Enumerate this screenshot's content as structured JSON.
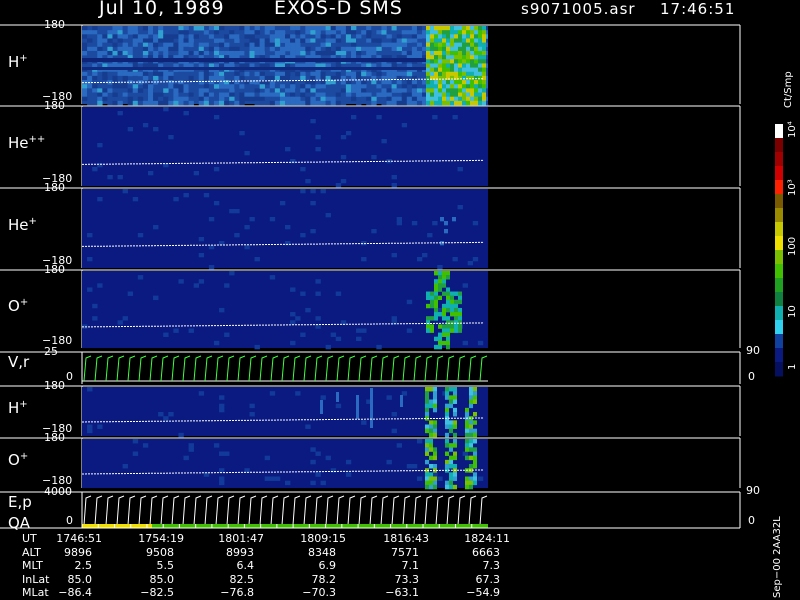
{
  "header": {
    "date": "Jul 10, 1989",
    "instrument": "EXOS-D SMS",
    "file": "s9071005.asr",
    "time": "17:46:51"
  },
  "panels": [
    {
      "label_main": "H",
      "label_sup": "+",
      "top_tick": "180",
      "bottom_tick": "−180"
    },
    {
      "label_main": "He",
      "label_sup": "++",
      "top_tick": "180",
      "bottom_tick": "−180"
    },
    {
      "label_main": "He",
      "label_sup": "+",
      "top_tick": "180",
      "bottom_tick": "−180"
    },
    {
      "label_main": "O",
      "label_sup": "+",
      "top_tick": "180",
      "bottom_tick": "−180"
    },
    {
      "label_main": "V,r",
      "label_sup": "",
      "top_tick": "25",
      "bottom_tick": "0",
      "right_top": "90",
      "right_bottom": "0"
    },
    {
      "label_main": "H",
      "label_sup": "+",
      "top_tick": "180",
      "bottom_tick": "−180"
    },
    {
      "label_main": "O",
      "label_sup": "+",
      "top_tick": "180",
      "bottom_tick": "−180"
    },
    {
      "label_main": "E,p",
      "label_sup": "",
      "label2": "QA",
      "top_tick": "4000",
      "bottom_tick": "0",
      "right_top": "90",
      "right_bottom": "0"
    }
  ],
  "colorbar": {
    "title": "Ct/Smp",
    "tick_labels": [
      "10⁴",
      "10³",
      "100",
      "10",
      "1"
    ],
    "colors": [
      "#ffffff",
      "#7a0000",
      "#a00000",
      "#d00000",
      "#ff2000",
      "#7a5a00",
      "#9a8a00",
      "#c8c800",
      "#f0e000",
      "#7ac000",
      "#40c000",
      "#20a020",
      "#108040",
      "#10b0b0",
      "#30d0f0",
      "#1040a0",
      "#0a1a80",
      "#061060"
    ]
  },
  "ephemeris": {
    "rows": [
      {
        "name": "UT",
        "values": [
          "1746:51",
          "1754:19",
          "1801:47",
          "1809:15",
          "1816:43",
          "1824:11"
        ]
      },
      {
        "name": "ALT",
        "values": [
          "9896",
          "9508",
          "8993",
          "8348",
          "7571",
          "6663"
        ]
      },
      {
        "name": "MLT",
        "values": [
          "2.5",
          "5.5",
          "6.4",
          "6.9",
          "7.1",
          "7.3"
        ]
      },
      {
        "name": "InLat",
        "values": [
          "85.0",
          "85.0",
          "82.5",
          "78.2",
          "73.3",
          "67.3"
        ]
      },
      {
        "name": "MLat",
        "values": [
          "−86.4",
          "−82.5",
          "−76.8",
          "−70.3",
          "−63.1",
          "−54.9"
        ]
      }
    ]
  },
  "footer": {
    "processed": "Sep−00 2AA32L"
  },
  "chart_data": {
    "type": "heatmap",
    "title": "Jul 10, 1989   EXOS-D SMS",
    "x": [
      "1746:51",
      "1754:19",
      "1801:47",
      "1809:15",
      "1816:43",
      "1824:11"
    ],
    "ylim": [
      -180,
      180
    ],
    "series": [
      {
        "name": "H+",
        "background": "medium",
        "activity_start_ut": "1819"
      },
      {
        "name": "He++",
        "background": "low"
      },
      {
        "name": "He+",
        "background": "low",
        "activity_start_ut": "1819"
      },
      {
        "name": "O+",
        "background": "low",
        "activity_start_ut": "1819"
      },
      {
        "name": "V,r",
        "ylim": [
          0,
          25
        ]
      },
      {
        "name": "H+",
        "background": "low",
        "activity_start_ut": "1818"
      },
      {
        "name": "O+",
        "background": "low",
        "activity_start_ut": "1819"
      },
      {
        "name": "E,p",
        "ylim": [
          0,
          4000
        ]
      }
    ]
  }
}
